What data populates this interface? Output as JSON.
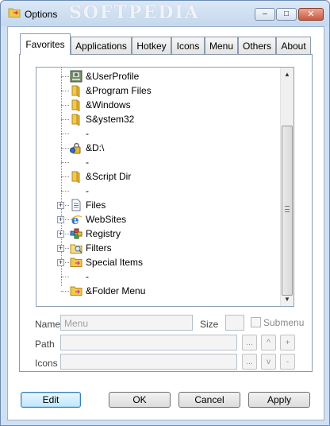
{
  "window": {
    "title": "Options",
    "watermark": "SOFTPEDIA",
    "minimize_glyph": "–",
    "maximize_glyph": "□",
    "close_glyph": "✕"
  },
  "tabs": [
    {
      "label": "Favorites",
      "active": true
    },
    {
      "label": "Applications",
      "active": false
    },
    {
      "label": "Hotkey",
      "active": false
    },
    {
      "label": "Icons",
      "active": false
    },
    {
      "label": "Menu",
      "active": false
    },
    {
      "label": "Others",
      "active": false
    },
    {
      "label": "About",
      "active": false
    }
  ],
  "tree": {
    "items": [
      {
        "label": "&UserProfile",
        "icon": "user-profile-icon",
        "expandable": false
      },
      {
        "label": "&Program Files",
        "icon": "folder-icon",
        "expandable": false
      },
      {
        "label": "&Windows",
        "icon": "folder-icon",
        "expandable": false
      },
      {
        "label": "S&ystem32",
        "icon": "folder-icon",
        "expandable": false
      },
      {
        "label": "-",
        "icon": "",
        "expandable": false
      },
      {
        "label": "&D:\\",
        "icon": "drive-icon",
        "expandable": false
      },
      {
        "label": "-",
        "icon": "",
        "expandable": false
      },
      {
        "label": "&Script Dir",
        "icon": "folder-icon",
        "expandable": false
      },
      {
        "label": "-",
        "icon": "",
        "expandable": false
      },
      {
        "label": "Files",
        "icon": "files-icon",
        "expandable": true
      },
      {
        "label": "WebSites",
        "icon": "internet-explorer-icon",
        "expandable": true
      },
      {
        "label": "Registry",
        "icon": "registry-icon",
        "expandable": true
      },
      {
        "label": "Filters",
        "icon": "filter-folder-icon",
        "expandable": true
      },
      {
        "label": "Special Items",
        "icon": "special-folder-icon",
        "expandable": true
      },
      {
        "label": "-",
        "icon": "",
        "expandable": false
      },
      {
        "label": "&Folder Menu",
        "icon": "folder-menu-icon",
        "expandable": false
      }
    ],
    "expander_glyph": "+",
    "scroll_up_glyph": "▲",
    "scroll_down_glyph": "▼"
  },
  "form": {
    "name_label": "Name",
    "name_placeholder": "Menu",
    "size_label": "Size",
    "submenu_label": "Submenu",
    "path_label": "Path",
    "icons_label": "Icons",
    "browse_glyph": "...",
    "up_glyph": "^",
    "down_glyph": "v",
    "add_glyph": "+",
    "remove_glyph": "-"
  },
  "buttons": {
    "edit": "Edit",
    "ok": "OK",
    "cancel": "Cancel",
    "apply": "Apply"
  },
  "colors": {
    "title_bar": "#c4d8ee",
    "close_button": "#c85a40",
    "folder": "#f2c94c",
    "default_button": "#bee6fd"
  }
}
